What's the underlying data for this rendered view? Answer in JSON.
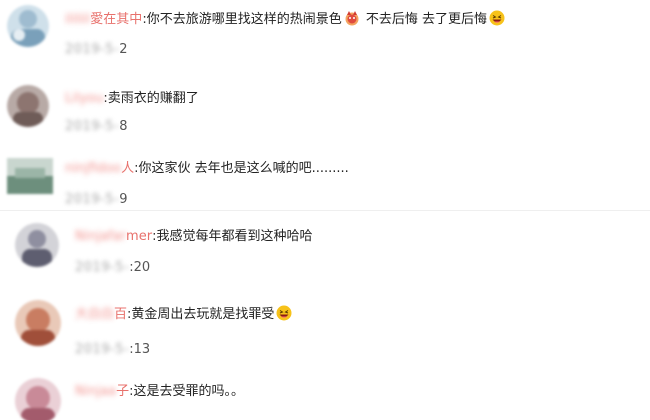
{
  "comments": [
    {
      "username_blurred": "ililiil",
      "username_visible": "愛在其中",
      "colon": ":",
      "text_a": "你不去旅游哪里找这样的热闹景色",
      "text_b": " 不去后悔 去了更后悔",
      "emoji_1": "thinking-face-emoji",
      "emoji_2": "laughing-face-emoji",
      "time_blurred": "2019-5-",
      "time_visible": "2"
    },
    {
      "username_blurred": "Lilyou",
      "username_visible": "",
      "colon": ":",
      "text_a": "卖雨衣的赚翻了",
      "time_blurred": "2019-5-",
      "time_visible": "8"
    },
    {
      "username_blurred": "ninjfidoo",
      "username_visible": "人",
      "colon": ":",
      "text_a": "你这家伙 去年也是这么喊的吧.........",
      "time_blurred": "2019-5-",
      "time_visible": "9"
    },
    {
      "username_blurred": "Ninjafar",
      "username_visible": "mer",
      "colon": ":",
      "text_a": "我感觉每年都看到这种哈哈",
      "time_blurred": "2019-5-",
      "time_visible": ":20"
    },
    {
      "username_blurred": "大白白",
      "username_visible": "百",
      "colon": ":",
      "text_a": "黄金周出去玩就是找罪受",
      "emoji_2": "laughing-face-emoji",
      "time_blurred": "2019-5-",
      "time_visible": ":13"
    },
    {
      "username_blurred": "Ninjaa",
      "username_visible": "子",
      "colon": ":",
      "text_a": "这是去受罪的吗。。",
      "time_blurred": "",
      "time_visible": ""
    }
  ],
  "colors": {
    "username": "#f0817c",
    "text": "#222222",
    "timestamp": "#555555"
  }
}
